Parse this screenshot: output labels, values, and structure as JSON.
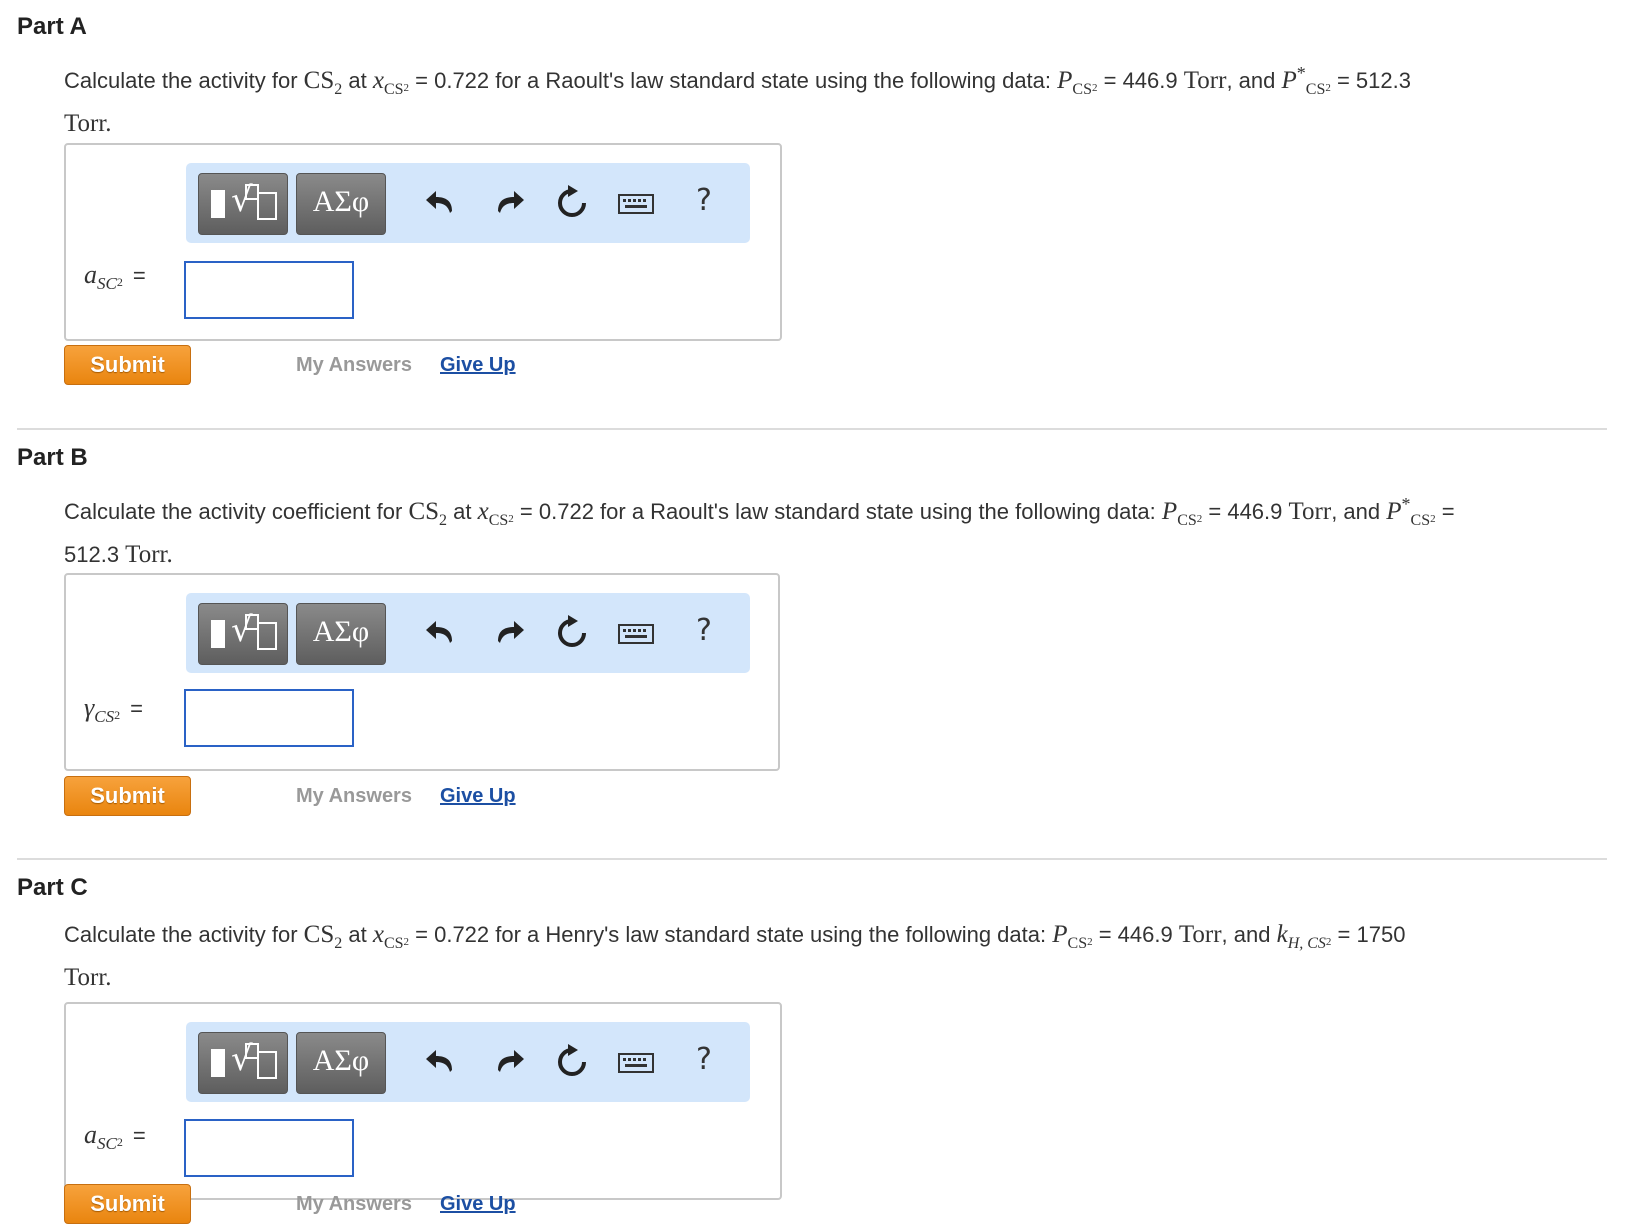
{
  "parts": [
    {
      "title": "Part A",
      "q": {
        "pre": "Calculate the activity for ",
        "species": "CS",
        "species_sub": "2",
        "at": " at ",
        "x_var": "x",
        "x_sub": "CS",
        "x_sub2": "2",
        "x_value": " = 0.722 for a Raoult's law standard state using the following data: ",
        "p_var": "P",
        "p_sub": "CS",
        "p_sub2": "2",
        "p_value": " = 446.9 ",
        "unit1": "Torr",
        "and": ", and ",
        "p2_var": "P",
        "p2_sup": "*",
        "p2_sub": "CS",
        "p2_sub2": "2",
        "p2_value": " = 512.3",
        "unit2": "Torr",
        "end": "."
      },
      "var_symbol": "a",
      "var_sub": "SC",
      "var_sub2": "2",
      "equals": "=",
      "input_value": ""
    },
    {
      "title": "Part B",
      "q": {
        "pre": "Calculate the activity coefficient for ",
        "species": "CS",
        "species_sub": "2",
        "at": " at ",
        "x_var": "x",
        "x_sub": "CS",
        "x_sub2": "2",
        "x_value": " = 0.722 for a Raoult's law standard state using the following data: ",
        "p_var": "P",
        "p_sub": "CS",
        "p_sub2": "2",
        "p_value": " = 446.9 ",
        "unit1": "Torr",
        "and": ", and ",
        "p2_var": "P",
        "p2_sup": "*",
        "p2_sub": "CS",
        "p2_sub2": "2",
        "p2_value": " = ",
        "p2_value_line2": "512.3 ",
        "unit2": "Torr",
        "end": "."
      },
      "var_symbol": "γ",
      "var_sub": "CS",
      "var_sub2": "2",
      "equals": "=",
      "input_value": ""
    },
    {
      "title": "Part C",
      "q": {
        "pre": "Calculate the activity for ",
        "species": "CS",
        "species_sub": "2",
        "at": " at ",
        "x_var": "x",
        "x_sub": "CS",
        "x_sub2": "2",
        "x_value": " = 0.722 for a Henry's law standard state using the following data: ",
        "p_var": "P",
        "p_sub": "CS",
        "p_sub2": "2",
        "p_value": " = 446.9 ",
        "unit1": "Torr",
        "and": ", and ",
        "k_var": "k",
        "k_sub": "H, CS",
        "k_sub2": "2",
        "k_value": " = 1750",
        "unit2": "Torr",
        "end": "."
      },
      "var_symbol": "a",
      "var_sub": "SC",
      "var_sub2": "2",
      "equals": "=",
      "input_value": ""
    }
  ],
  "toolbar": {
    "greek_label": "ΑΣφ",
    "root_glyph": "√",
    "help_label": "?"
  },
  "actions": {
    "submit_label": "Submit",
    "my_answers_label": "My Answers",
    "give_up_label": "Give Up"
  },
  "colors": {
    "submit": "#f29a2e",
    "link": "#1c4fa3",
    "toolbar_bg": "#d3e6fb",
    "input_border": "#2a62c6"
  }
}
